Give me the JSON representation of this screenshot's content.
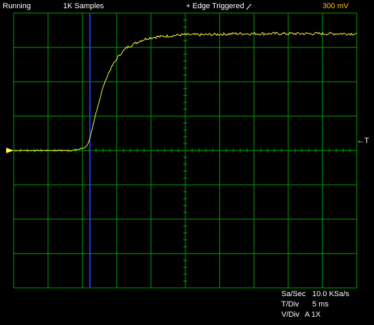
{
  "status": {
    "run_state": "Running",
    "samples": "1K Samples",
    "trigger": "+ Edge Triggered",
    "trigger_slope_icon": "rising-edge-icon",
    "volts_per_div": "300 mV"
  },
  "trigger_marker": {
    "label": "←T",
    "icon": "trigger-arrow-icon"
  },
  "ground_marker": {
    "icon": "channel-ground-arrow-icon"
  },
  "readouts": {
    "sample_rate_label": "Sa/Sec",
    "sample_rate_value": "10.0 KSa/s",
    "time_div_label": "T/Div",
    "time_div_value": "5 ms",
    "volt_div_label": "V/Div",
    "volt_div_value": "A 1X"
  },
  "colors": {
    "background": "#000000",
    "grid": "#00a800",
    "trace": "#ffff40",
    "cursor": "#2030ff",
    "status_accent": "#ffcc00",
    "text": "#ffffff"
  },
  "chart_data": {
    "type": "line",
    "title": "",
    "xlabel": "",
    "ylabel": "",
    "x_unit": "ms",
    "y_unit": "V",
    "xlim": [
      -12.5,
      37.5
    ],
    "ylim": [
      -1.2,
      1.2
    ],
    "grid": true,
    "cursor_x": -1.4,
    "series": [
      {
        "x": [
          -12.5,
          -8,
          -4,
          -3,
          -2,
          -1.5,
          -1,
          -0.5,
          0,
          0.5,
          1,
          1.5,
          2,
          2.5,
          3,
          3.5,
          4,
          5,
          6,
          7,
          8,
          10,
          12,
          15,
          20,
          25,
          30,
          37.5
        ],
        "y": [
          0.0,
          0.0,
          0.0,
          0.01,
          0.03,
          0.08,
          0.2,
          0.33,
          0.44,
          0.55,
          0.63,
          0.7,
          0.75,
          0.8,
          0.84,
          0.87,
          0.9,
          0.93,
          0.96,
          0.98,
          0.99,
          1.0,
          1.01,
          1.01,
          1.02,
          1.02,
          1.02,
          1.02
        ]
      }
    ]
  }
}
